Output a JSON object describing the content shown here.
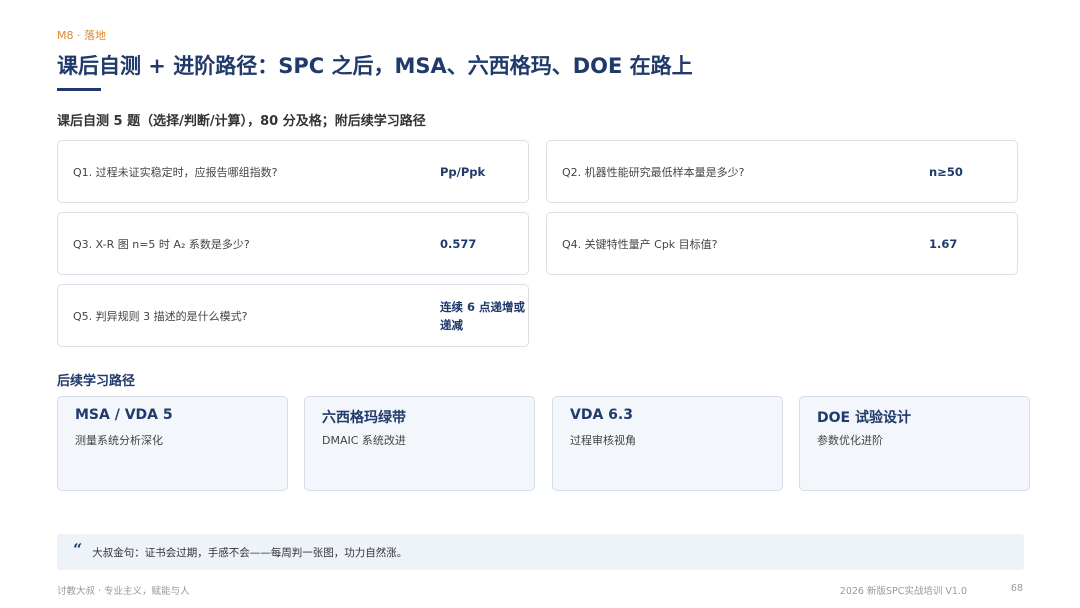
{
  "header": {
    "tag": "M8 · 落地",
    "title": "课后自测 + 进阶路径：SPC 之后，MSA、六西格玛、DOE 在路上",
    "subtitle": "课后自测 5 题（选择/判断/计算），80 分及格；附后续学习路径"
  },
  "questions": [
    {
      "q": "Q1. 过程未证实稳定时，应报告哪组指数?",
      "a": "Pp/Ppk"
    },
    {
      "q": "Q2. 机器性能研究最低样本量是多少?",
      "a": "n≥50"
    },
    {
      "q": "Q3. X-R 图 n=5 时 A₂ 系数是多少?",
      "a": "0.577"
    },
    {
      "q": "Q4. 关键特性量产 Cpk 目标值?",
      "a": "1.67"
    },
    {
      "q": "Q5. 判异规则 3 描述的是什么模式?",
      "a": "连续 6 点递增或递减"
    }
  ],
  "path": {
    "title": "后续学习路径",
    "items": [
      {
        "name": "MSA / VDA 5",
        "desc": "测量系统分析深化"
      },
      {
        "name": "六西格玛绿带",
        "desc": "DMAIC 系统改进"
      },
      {
        "name": "VDA 6.3",
        "desc": "过程审核视角"
      },
      {
        "name": "DOE 试验设计",
        "desc": "参数优化进阶"
      }
    ]
  },
  "quote": {
    "icon": "quote-icon",
    "text": "大叔金句：证书会过期，手感不会——每周判一张图，功力自然涨。"
  },
  "footer": {
    "left": "讨教大叔 · 专业主义，赋能与人",
    "right": "2026 新版SPC实战培训 V1.0",
    "page": "68"
  },
  "colors": {
    "accent": "#1f3a6b",
    "tag": "#e08a2c",
    "card_bg": "#f3f6fb",
    "quote_bg": "#eef3f9"
  }
}
